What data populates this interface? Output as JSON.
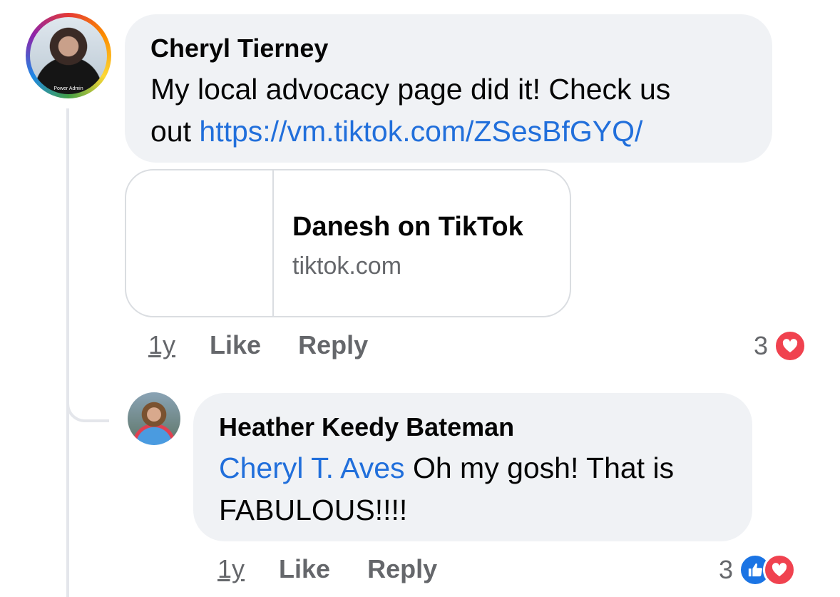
{
  "comment": {
    "author": "Cheryl Tierney",
    "text_line1": "My local advocacy page did it!  Check us",
    "text_line2_prefix": "out ",
    "link_text": "https://vm.tiktok.com/ZSesBfGYQ/",
    "avatar_badge": "Power Admin",
    "link_preview": {
      "title": "Danesh on TikTok",
      "domain": "tiktok.com"
    },
    "time": "1y",
    "like_label": "Like",
    "reply_label": "Reply",
    "reaction_count": "3",
    "reactions": [
      "love"
    ]
  },
  "reply": {
    "author": "Heather Keedy Bateman",
    "mention": "Cheryl T. Aves",
    "text_after_mention": " Oh my gosh! That is",
    "text_line2": "FABULOUS!!!!",
    "time": "1y",
    "like_label": "Like",
    "reply_label": "Reply",
    "reaction_count": "3",
    "reactions": [
      "like",
      "love"
    ]
  },
  "colors": {
    "bubble": "#f0f2f5",
    "link": "#216fdb",
    "secondary_text": "#65676b",
    "like_blue": "#1b74e4",
    "love_red": "#f0424f"
  }
}
